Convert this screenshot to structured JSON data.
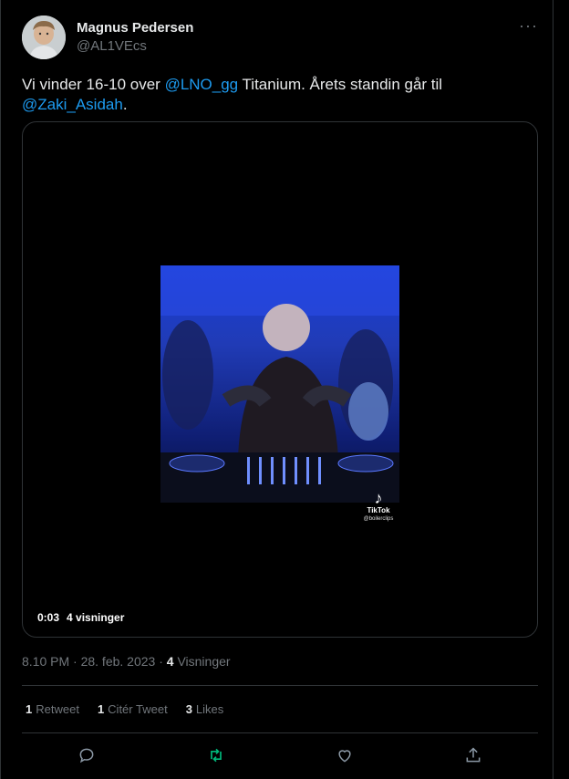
{
  "user": {
    "name": "Magnus Pedersen",
    "handle": "@AL1VEcs",
    "more_label": "···"
  },
  "tweet": {
    "text_1": "Vi vinder 16-10 over ",
    "mention_1": "@LNO_gg",
    "text_2": " Titanium. Årets standin går til ",
    "mention_2": "@Zaki_Asidah",
    "text_3": "."
  },
  "video": {
    "duration": "0:03",
    "views": "4 visninger",
    "watermark": "TikTok",
    "watermark_user": "@boilerclips"
  },
  "meta": {
    "time_date": "8.10 PM · 28. feb. 2023 · ",
    "views_count": "4",
    "views_label": " Visninger"
  },
  "stats": {
    "retweets_count": "1",
    "retweets_label": "Retweet",
    "quotes_count": "1",
    "quotes_label": "Citér Tweet",
    "likes_count": "3",
    "likes_label": "Likes"
  },
  "colors": {
    "background": "#000000",
    "accent": "#1d9bf0",
    "retweet_active": "#00ba7c",
    "muted": "#71767b"
  },
  "icons": [
    "more-icon",
    "reply-icon",
    "retweet-icon",
    "like-icon",
    "share-icon",
    "tiktok-icon"
  ]
}
